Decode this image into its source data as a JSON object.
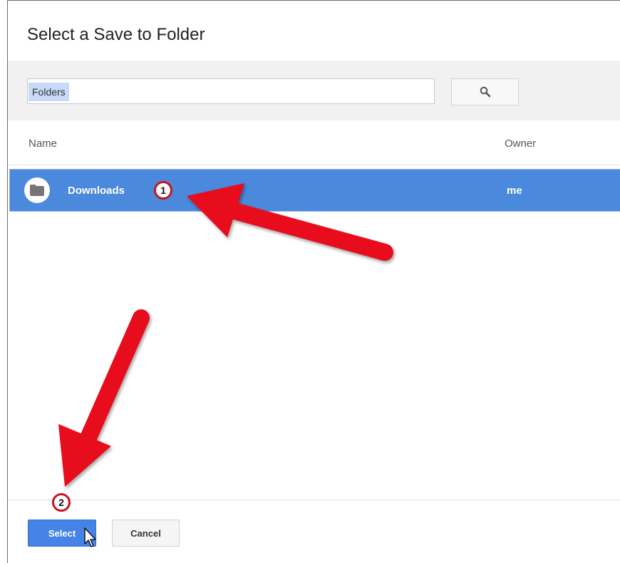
{
  "dialog": {
    "title": "Select a Save to Folder"
  },
  "search": {
    "chip_label": "Folders",
    "button_icon": "search-icon"
  },
  "table": {
    "columns": [
      "Name",
      "Owner"
    ],
    "rows": [
      {
        "name": "Downloads",
        "owner": "me",
        "icon": "folder-icon",
        "selected": true
      }
    ]
  },
  "footer": {
    "select_label": "Select",
    "cancel_label": "Cancel"
  },
  "annotations": [
    {
      "number": "1",
      "target": "Downloads"
    },
    {
      "number": "2",
      "target": "Select"
    }
  ],
  "colors": {
    "selection": "#4a89dc",
    "primary_button": "#4584e6",
    "annotation_arrow": "#e8101a"
  }
}
